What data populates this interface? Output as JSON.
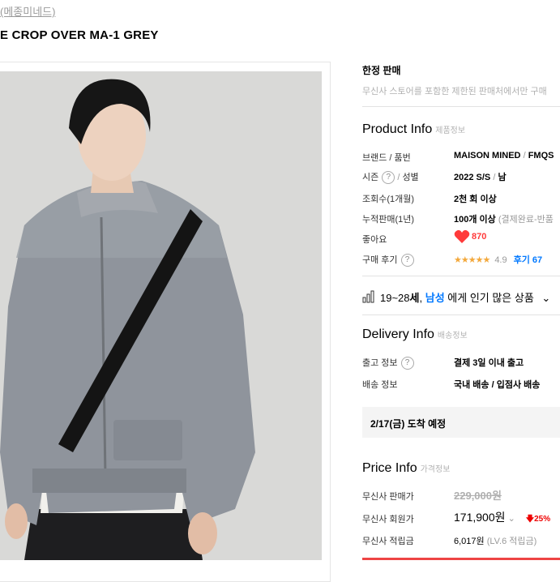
{
  "header": {
    "brand_link": "(메종미네드)",
    "product_title": "E CROP OVER MA-1 GREY"
  },
  "limited": {
    "title": "한정 판매",
    "description": "무신사 스토어를 포함한 제한된 판매처에서만 구매"
  },
  "product_info": {
    "title": "Product Info",
    "sub": "제품정보",
    "brand_label": "브랜드 / 품번",
    "brand_value": "MAISON MINED",
    "sku_sep": "/",
    "sku_value": "FMQS",
    "season_label": "시즌",
    "season_sep": "/",
    "gender_label": "성별",
    "season_value": "2022 S/S",
    "gender_value": "남",
    "views_label": "조회수(1개월)",
    "views_value": "2천 회 이상",
    "sales_label": "누적판매(1년)",
    "sales_value": "100개 이상",
    "sales_note": "(결제완료-반품",
    "likes_label": "좋아요",
    "likes_value": "870",
    "review_label": "구매 후기",
    "rating_stars": "★★★★★",
    "rating_value": "4.9",
    "review_count": "후기 67"
  },
  "popular": {
    "age_range": "19~28",
    "age_suffix": "세",
    "comma": ",",
    "gender": "남성",
    "text": "에게 인기 많은 상품"
  },
  "delivery_info": {
    "title": "Delivery Info",
    "sub": "배송정보",
    "ship_label": "출고 정보",
    "ship_value": "결제 3일 이내 출고",
    "method_label": "배송 정보",
    "method_value": "국내 배송 / 입점사 배송",
    "arrival": "2/17(금) 도착 예정"
  },
  "price_info": {
    "title": "Price Info",
    "sub": "가격정보",
    "sale_label": "무신사 판매가",
    "sale_value": "229,000원",
    "member_label": "무신사 회원가",
    "member_value": "171,900원",
    "discount": "25%",
    "points_label": "무신사 적립금",
    "points_value": "6,017원",
    "points_note": "(LV.6 적립금)"
  },
  "colors": {
    "accent_blue": "#0078ff",
    "heart_red": "#ff3a3a",
    "star": "#f3a83b"
  }
}
